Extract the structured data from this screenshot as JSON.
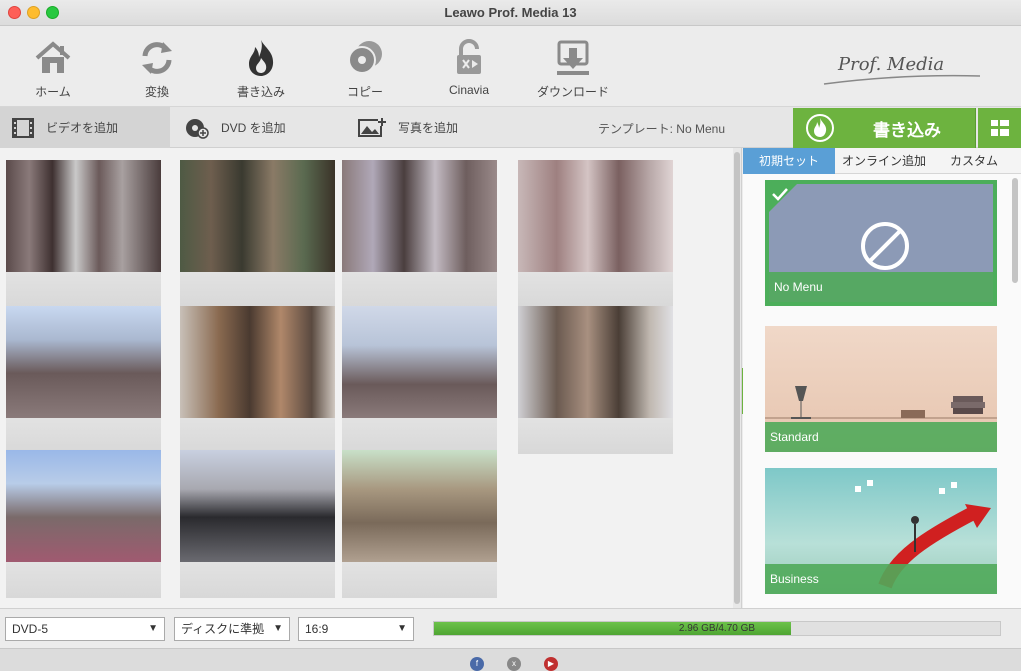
{
  "window": {
    "title": "Leawo Prof. Media 13"
  },
  "toolbar": {
    "items": [
      {
        "label": "ホーム",
        "icon": "home-icon"
      },
      {
        "label": "変換",
        "icon": "convert-icon"
      },
      {
        "label": "書き込み",
        "icon": "burn-icon"
      },
      {
        "label": "コピー",
        "icon": "copy-icon"
      },
      {
        "label": "Cinavia",
        "icon": "cinavia-icon"
      },
      {
        "label": "ダウンロード",
        "icon": "download-icon"
      }
    ],
    "brand": "Prof. Media"
  },
  "actions": {
    "add_video": "ビデオを追加",
    "add_dvd": "DVD を追加",
    "add_photo": "写真を追加",
    "template_label": "テンプレート: No Menu",
    "burn": "書き込み"
  },
  "template_panel": {
    "tabs": [
      "初期セット",
      "オンライン追加",
      "カスタム"
    ],
    "active_tab": "初期セット",
    "templates": [
      {
        "name": "No Menu",
        "selected": true
      },
      {
        "name": "Standard",
        "selected": false
      },
      {
        "name": "Business",
        "selected": false
      }
    ]
  },
  "bottom": {
    "disc_type": "DVD-5",
    "quality": "ディスクに準拠",
    "aspect": "16:9",
    "usage_text": "2.96 GB/4.70 GB",
    "usage_fraction": 0.63
  },
  "colors": {
    "accent_green": "#6db33f",
    "tab_blue": "#5a9fd6"
  }
}
